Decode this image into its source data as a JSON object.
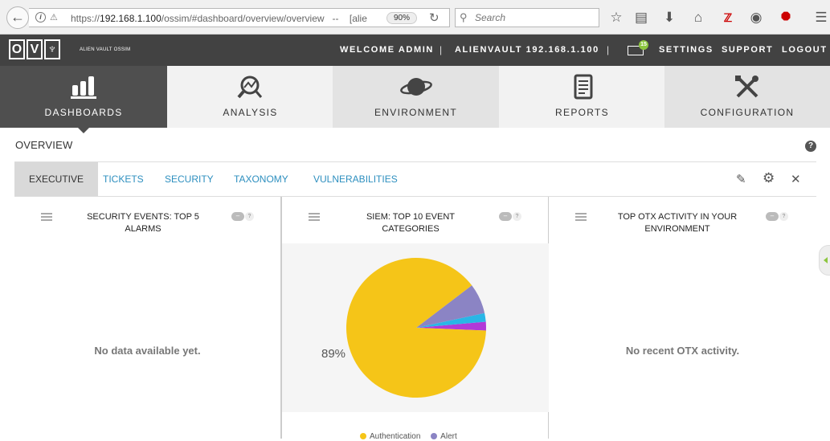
{
  "browser": {
    "url_prefix": "https://",
    "url_host": "192.168.1.100",
    "url_path": "/ossim/#dashboard/overview/overview",
    "url_tail": "   --    [alie",
    "zoom": "90%",
    "search_placeholder": "Search"
  },
  "app": {
    "logo_letters": [
      "O",
      "V",
      "♆"
    ],
    "logo_text": "ALIEN VAULT OSSIM",
    "welcome": "WELCOME ADMIN",
    "host": "ALIENVAULT 192.168.1.100",
    "message_count": "15",
    "settings": "SETTINGS",
    "support": "SUPPORT",
    "logout": "LOGOUT"
  },
  "nav": {
    "items": [
      {
        "label": "DASHBOARDS",
        "icon": "bar-chart-icon",
        "active": true
      },
      {
        "label": "ANALYSIS",
        "icon": "magnifier-chart-icon"
      },
      {
        "label": "ENVIRONMENT",
        "icon": "planet-icon"
      },
      {
        "label": "REPORTS",
        "icon": "report-document-icon"
      },
      {
        "label": "CONFIGURATION",
        "icon": "tools-icon"
      }
    ]
  },
  "overview": {
    "title": "OVERVIEW",
    "help": "?"
  },
  "subtabs": {
    "items": [
      "EXECUTIVE",
      "TICKETS",
      "SECURITY",
      "TAXONOMY",
      "VULNERABILITIES"
    ],
    "active": "EXECUTIVE"
  },
  "panels": {
    "security_events": {
      "title": "SECURITY EVENTS: TOP 5 ALARMS",
      "empty": "No data available yet."
    },
    "siem": {
      "title": "SIEM: TOP 10 EVENT CATEGORIES",
      "pct_label": "89%"
    },
    "otx": {
      "title_line1": "TOP OTX ACTIVITY IN YOUR",
      "title_line2": "ENVIRONMENT",
      "empty": "No recent OTX activity."
    }
  },
  "chart_data": {
    "type": "pie",
    "title": "SIEM: TOP 10 EVENT CATEGORIES",
    "slices": [
      {
        "label": "Authentication",
        "value": 89,
        "color": "#f5c518"
      },
      {
        "label": "Alert",
        "value": 7,
        "color": "#8b84c4"
      },
      {
        "label": "",
        "value": 2,
        "color": "#29b6e6"
      },
      {
        "label": "",
        "value": 2,
        "color": "#b13ad8"
      }
    ],
    "data_labels": [
      "89%"
    ]
  },
  "colors": {
    "header": "#424242",
    "active_tab": "#4f4f4f",
    "link": "#2d8fbf",
    "badge": "#8cc63f"
  }
}
